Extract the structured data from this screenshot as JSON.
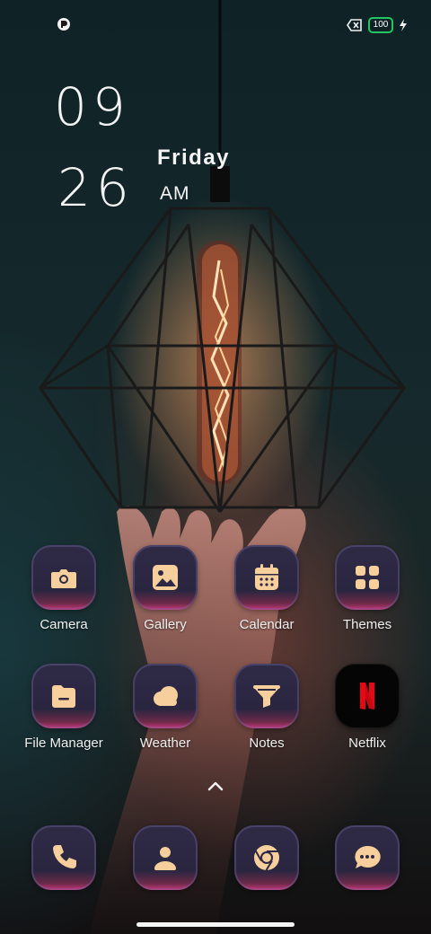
{
  "status_bar": {
    "left_icon": "app-notification-icon",
    "right_icons": [
      "sim-x-icon",
      "battery-icon",
      "charging-bolt-icon"
    ],
    "battery_level": "100"
  },
  "clock": {
    "hour": "09",
    "minute": "26",
    "day": "Friday",
    "ampm": "AM"
  },
  "apps": [
    {
      "label": "Camera",
      "icon": "camera-icon"
    },
    {
      "label": "Gallery",
      "icon": "gallery-icon"
    },
    {
      "label": "Calendar",
      "icon": "calendar-icon"
    },
    {
      "label": "Themes",
      "icon": "themes-icon"
    },
    {
      "label": "File Manager",
      "icon": "folder-icon"
    },
    {
      "label": "Weather",
      "icon": "cloud-icon"
    },
    {
      "label": "Notes",
      "icon": "notes-icon"
    },
    {
      "label": "Netflix",
      "icon": "netflix-icon"
    }
  ],
  "dock": [
    {
      "icon": "phone-icon"
    },
    {
      "icon": "contacts-icon"
    },
    {
      "icon": "chrome-icon"
    },
    {
      "icon": "messages-icon"
    }
  ],
  "colors": {
    "icon_glyph": "#f6cf9c",
    "icon_bg": "#2d2944",
    "icon_accent": "#c9367a",
    "battery_outline": "#22c55e",
    "netflix_red": "#e50914"
  }
}
